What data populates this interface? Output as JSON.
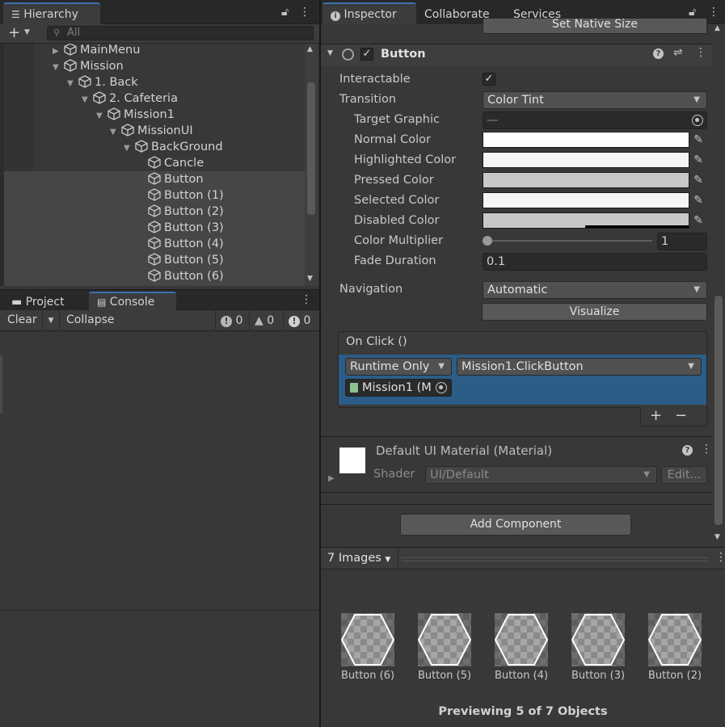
{
  "hierarchy": {
    "tab_label": "Hierarchy",
    "search_placeholder": "All",
    "items": [
      {
        "label": "MainMenu",
        "expanded": false
      },
      {
        "label": "Mission",
        "expanded": true
      },
      {
        "label": "1. Back",
        "expanded": true
      },
      {
        "label": "2. Cafeteria",
        "expanded": true
      },
      {
        "label": "Mission1",
        "expanded": true
      },
      {
        "label": "MissionUI",
        "expanded": true
      },
      {
        "label": "BackGround",
        "expanded": true
      },
      {
        "label": "Cancle"
      },
      {
        "label": "Button"
      },
      {
        "label": "Button (1)"
      },
      {
        "label": "Button (2)"
      },
      {
        "label": "Button (3)"
      },
      {
        "label": "Button (4)"
      },
      {
        "label": "Button (5)"
      },
      {
        "label": "Button (6)"
      }
    ]
  },
  "console": {
    "tab_project": "Project",
    "tab_console": "Console",
    "clear_label": "Clear",
    "collapse_label": "Collapse",
    "info_count": "0",
    "warn_count": "0",
    "error_count": "0"
  },
  "inspector": {
    "tab_inspector": "Inspector",
    "tab_collaborate": "Collaborate",
    "tab_services": "Services",
    "set_native_size": "Set Native Size",
    "component_title": "Button",
    "props": {
      "interactable": "Interactable",
      "transition": "Transition",
      "transition_value": "Color Tint",
      "target_graphic": "Target Graphic",
      "target_graphic_value": "—",
      "normal_color": "Normal Color",
      "highlighted_color": "Highlighted Color",
      "pressed_color": "Pressed Color",
      "selected_color": "Selected Color",
      "disabled_color": "Disabled Color",
      "color_multiplier": "Color Multiplier",
      "color_multiplier_value": "1",
      "fade_duration": "Fade Duration",
      "fade_duration_value": "0.1",
      "navigation": "Navigation",
      "navigation_value": "Automatic",
      "visualize": "Visualize"
    },
    "onclick": {
      "title": "On Click ()",
      "runtime": "Runtime Only",
      "function": "Mission1.ClickButton",
      "object": "Mission1 (M",
      "plus": "+",
      "minus": "−"
    },
    "material": {
      "title": "Default UI Material (Material)",
      "shader_label": "Shader",
      "shader_value": "UI/Default",
      "edit": "Edit..."
    },
    "add_component": "Add Component"
  },
  "preview": {
    "header": "7 Images",
    "items": [
      "Button (6)",
      "Button (5)",
      "Button (4)",
      "Button (3)",
      "Button (2)"
    ],
    "footer": "Previewing 5 of 7 Objects"
  },
  "colors": {
    "accent": "#3a72b0",
    "selection": "#2c5d87",
    "panel": "#383838"
  }
}
